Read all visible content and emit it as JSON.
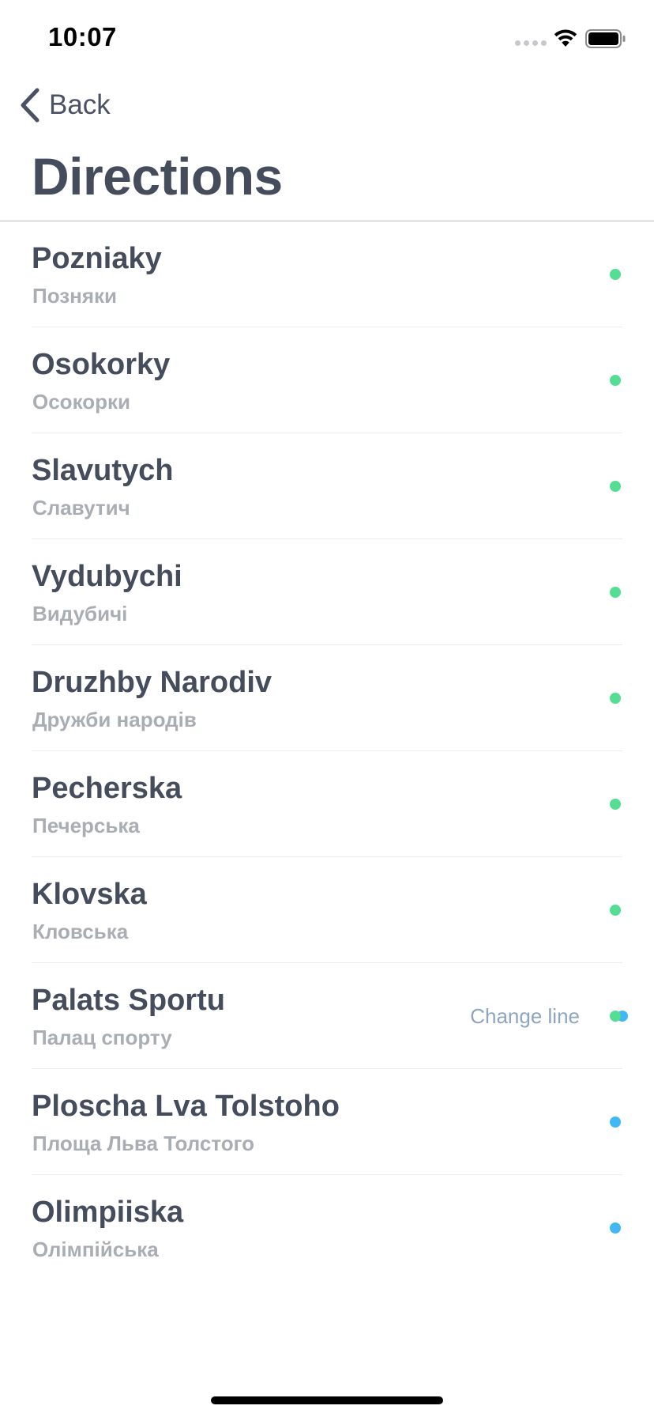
{
  "status_bar": {
    "time": "10:07"
  },
  "nav": {
    "back_label": "Back",
    "title": "Directions"
  },
  "colors": {
    "green": "#56dd94",
    "blue": "#41b8f4",
    "text": "#454c5c",
    "subtext": "#a9adb4"
  },
  "stations": [
    {
      "name": "Pozniaky",
      "native": "Позняки",
      "lines": [
        "green"
      ]
    },
    {
      "name": "Osokorky",
      "native": "Осокорки",
      "lines": [
        "green"
      ]
    },
    {
      "name": "Slavutych",
      "native": "Славутич",
      "lines": [
        "green"
      ]
    },
    {
      "name": "Vydubychi",
      "native": "Видубичі",
      "lines": [
        "green"
      ]
    },
    {
      "name": "Druzhby Narodiv",
      "native": "Дружби народів",
      "lines": [
        "green"
      ]
    },
    {
      "name": "Pecherska",
      "native": "Печерська",
      "lines": [
        "green"
      ]
    },
    {
      "name": "Klovska",
      "native": "Кловська",
      "lines": [
        "green"
      ]
    },
    {
      "name": "Palats Sportu",
      "native": "Палац спорту",
      "lines": [
        "green",
        "blue"
      ],
      "action": "Change line"
    },
    {
      "name": "Ploscha Lva Tolstoho",
      "native": "Площа Льва Толстого",
      "lines": [
        "blue"
      ]
    },
    {
      "name": "Olimpiiska",
      "native": "Олімпійська",
      "lines": [
        "blue"
      ]
    }
  ]
}
